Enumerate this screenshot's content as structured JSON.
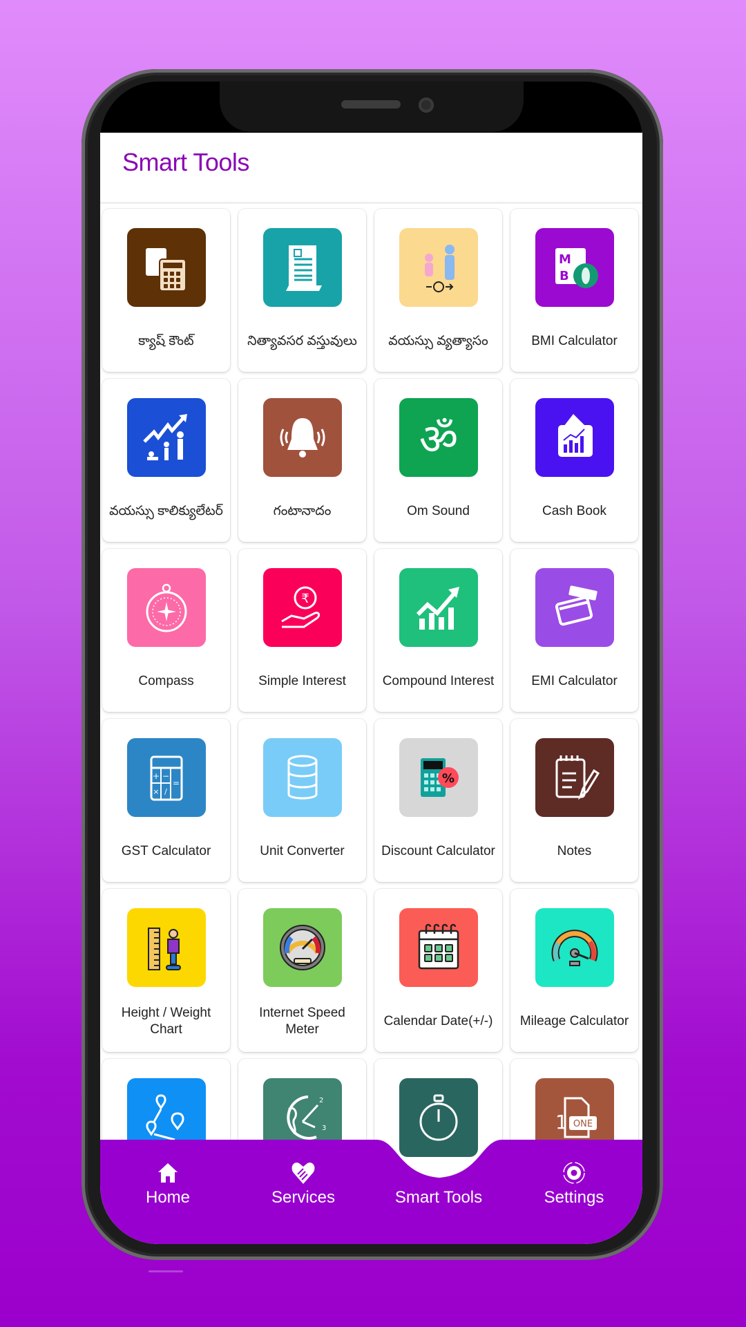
{
  "header": {
    "title": "Smart Tools"
  },
  "colors": {
    "accent": "#8a07b5",
    "nav_bg": "#9800d0",
    "fab": "#e8462e"
  },
  "tools": [
    {
      "label": "క్యాష్ కౌంట్",
      "icon": "cash-count-icon",
      "color": "#5e3107"
    },
    {
      "label": "నిత్యావసర వస్తువులు",
      "icon": "grocery-list-icon",
      "color": "#17a3a8"
    },
    {
      "label": "వయస్సు వ్యత్యాసం",
      "icon": "age-difference-icon",
      "color": "#fbd98f"
    },
    {
      "label": "BMI Calculator",
      "icon": "bmi-icon",
      "color": "#9b0ad0"
    },
    {
      "label": "వయస్సు కాలిక్యులేటర్",
      "icon": "age-calculator-icon",
      "color": "#1b4fd6"
    },
    {
      "label": "గంటానాదం",
      "icon": "bell-icon",
      "color": "#a0523d"
    },
    {
      "label": "Om Sound",
      "icon": "om-icon",
      "color": "#0ea452"
    },
    {
      "label": "Cash Book",
      "icon": "wallet-chart-icon",
      "color": "#4a12f0"
    },
    {
      "label": "Compass",
      "icon": "compass-icon",
      "color": "#fd6aa8"
    },
    {
      "label": "Simple Interest",
      "icon": "rupee-hand-icon",
      "color": "#fb0059"
    },
    {
      "label": "Compound Interest",
      "icon": "growth-chart-icon",
      "color": "#1fc07c"
    },
    {
      "label": "EMI Calculator",
      "icon": "credit-cards-icon",
      "color": "#9a4ce6"
    },
    {
      "label": "GST Calculator",
      "icon": "calculator-icon",
      "color": "#2c86c5"
    },
    {
      "label": "Unit Converter",
      "icon": "database-icon",
      "color": "#79ccf7"
    },
    {
      "label": "Discount Calculator",
      "icon": "discount-calculator-icon",
      "color": "#d7d7d7"
    },
    {
      "label": "Notes",
      "icon": "notes-icon",
      "color": "#5e2b25"
    },
    {
      "label": "Height / Weight Chart",
      "icon": "height-chart-icon",
      "color": "#fdd800"
    },
    {
      "label": "Internet Speed Meter",
      "icon": "speedometer-icon",
      "color": "#7dcb5b"
    },
    {
      "label": "Calendar Date(+/-)",
      "icon": "calendar-icon",
      "color": "#fb5c55"
    },
    {
      "label": "Mileage Calculator",
      "icon": "gauge-icon",
      "color": "#1ce6c4"
    },
    {
      "label": "",
      "icon": "route-map-icon",
      "color": "#0f90f5"
    },
    {
      "label": "",
      "icon": "world-clock-icon",
      "color": "#3f8572"
    },
    {
      "label": "",
      "icon": "stopwatch-icon",
      "color": "#2a6660"
    },
    {
      "label": "",
      "icon": "number-to-words-icon",
      "color": "#a4563d"
    }
  ],
  "nav": [
    {
      "label": "Home",
      "icon": "home-icon"
    },
    {
      "label": "Services",
      "icon": "heart-handshake-icon"
    },
    {
      "label": "Smart Tools",
      "icon": "smart-tools-gear-icon",
      "active": true
    },
    {
      "label": "Settings",
      "icon": "settings-gear-icon"
    }
  ]
}
